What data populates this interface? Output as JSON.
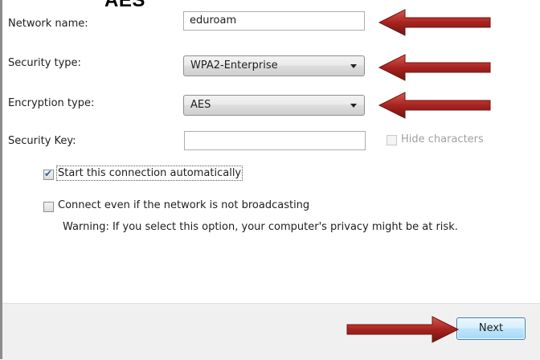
{
  "overlay": {
    "title": "AES"
  },
  "form": {
    "network_name": {
      "label": "Network name:",
      "value": "eduroam"
    },
    "security_type": {
      "label": "Security type:",
      "value": "WPA2-Enterprise"
    },
    "encryption_type": {
      "label": "Encryption type:",
      "value": "AES"
    },
    "security_key": {
      "label": "Security Key:",
      "value": "",
      "hide_characters_label": "Hide characters",
      "hide_characters_checked": false
    }
  },
  "options": {
    "start_automatically": {
      "label": "Start this connection automatically",
      "checked": true
    },
    "connect_not_broadcasting": {
      "label": "Connect even if the network is not broadcasting",
      "checked": false
    },
    "warning": "Warning: If you select this option, your computer's privacy might be at risk."
  },
  "footer": {
    "next_label": "Next"
  },
  "colors": {
    "annotation_arrow": "#a8231f",
    "button_border": "#3c7fb1",
    "footer_bg": "#f0f0f0"
  }
}
